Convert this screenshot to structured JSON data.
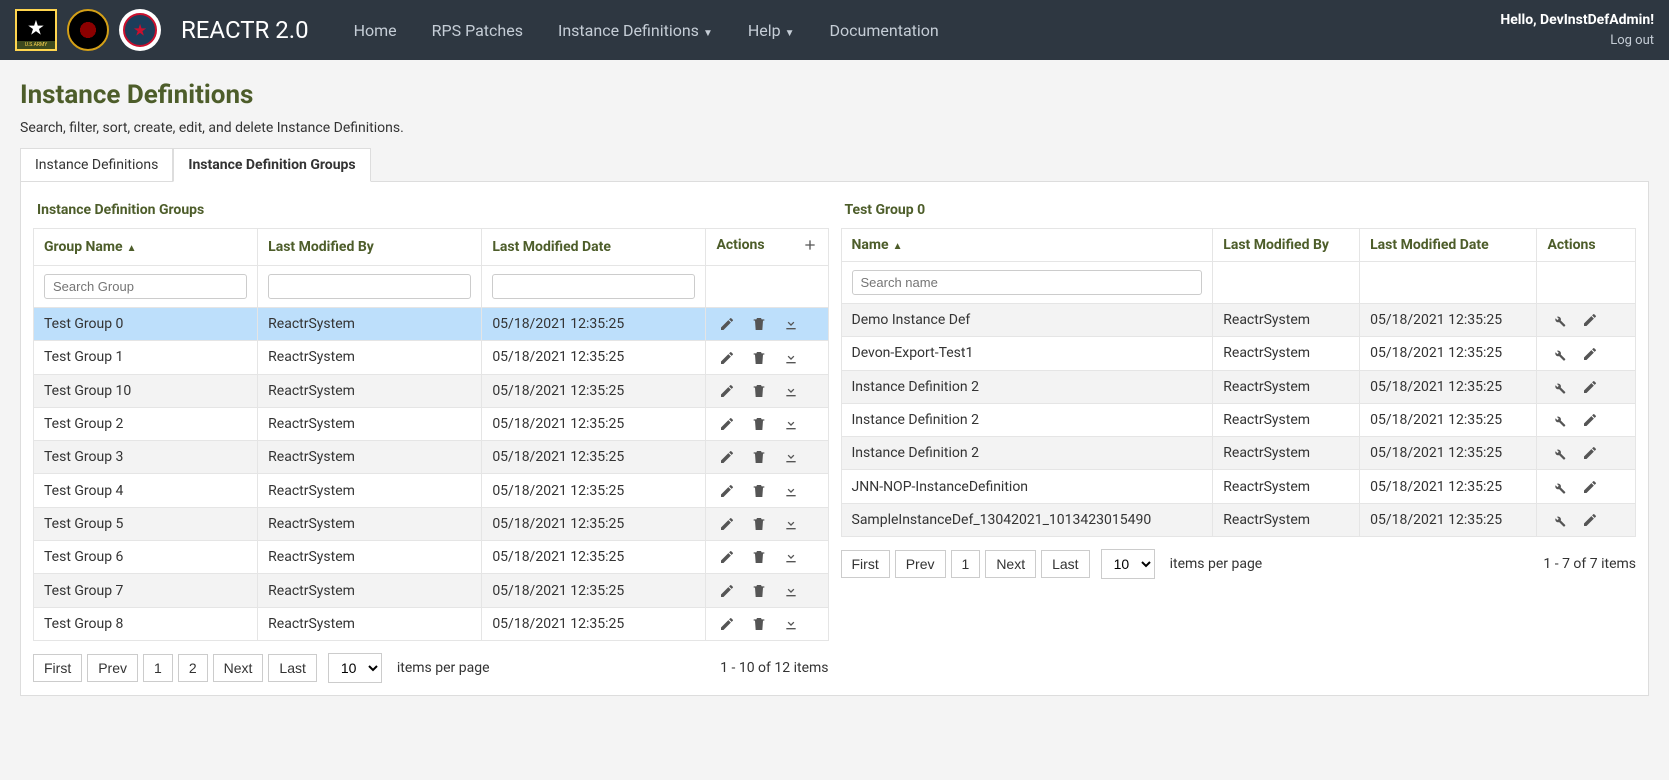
{
  "nav": {
    "brand": "REACTR 2.0",
    "links": {
      "home": "Home",
      "rps": "RPS Patches",
      "instdef": "Instance Definitions",
      "help": "Help",
      "docs": "Documentation"
    },
    "greeting": "Hello, DevInstDefAdmin!",
    "logout": "Log out"
  },
  "page": {
    "title": "Instance Definitions",
    "subtitle": "Search, filter, sort, create, edit, and delete Instance Definitions."
  },
  "tabs": {
    "t1": "Instance Definitions",
    "t2": "Instance Definition Groups"
  },
  "left": {
    "section_title": "Instance Definition Groups",
    "headers": {
      "name": "Group Name",
      "modified_by": "Last Modified By",
      "modified_date": "Last Modified Date",
      "actions": "Actions"
    },
    "search_placeholder": "Search Group",
    "rows": [
      {
        "name": "Test Group 0",
        "by": "ReactrSystem",
        "date": "05/18/2021 12:35:25",
        "selected": true
      },
      {
        "name": "Test Group 1",
        "by": "ReactrSystem",
        "date": "05/18/2021 12:35:25"
      },
      {
        "name": "Test Group 10",
        "by": "ReactrSystem",
        "date": "05/18/2021 12:35:25"
      },
      {
        "name": "Test Group 2",
        "by": "ReactrSystem",
        "date": "05/18/2021 12:35:25"
      },
      {
        "name": "Test Group 3",
        "by": "ReactrSystem",
        "date": "05/18/2021 12:35:25"
      },
      {
        "name": "Test Group 4",
        "by": "ReactrSystem",
        "date": "05/18/2021 12:35:25"
      },
      {
        "name": "Test Group 5",
        "by": "ReactrSystem",
        "date": "05/18/2021 12:35:25"
      },
      {
        "name": "Test Group 6",
        "by": "ReactrSystem",
        "date": "05/18/2021 12:35:25"
      },
      {
        "name": "Test Group 7",
        "by": "ReactrSystem",
        "date": "05/18/2021 12:35:25"
      },
      {
        "name": "Test Group 8",
        "by": "ReactrSystem",
        "date": "05/18/2021 12:35:25"
      }
    ],
    "pager": {
      "first": "First",
      "prev": "Prev",
      "p1": "1",
      "p2": "2",
      "next": "Next",
      "last": "Last",
      "size": "10",
      "per_page": "items per page",
      "summary": "1 - 10 of 12 items"
    }
  },
  "right": {
    "section_title": "Test Group 0",
    "headers": {
      "name": "Name",
      "modified_by": "Last Modified By",
      "modified_date": "Last Modified Date",
      "actions": "Actions"
    },
    "search_placeholder": "Search name",
    "rows": [
      {
        "name": "Demo Instance Def",
        "by": "ReactrSystem",
        "date": "05/18/2021 12:35:25"
      },
      {
        "name": "Devon-Export-Test1",
        "by": "ReactrSystem",
        "date": "05/18/2021 12:35:25"
      },
      {
        "name": "Instance Definition 2",
        "by": "ReactrSystem",
        "date": "05/18/2021 12:35:25"
      },
      {
        "name": "Instance Definition 2",
        "by": "ReactrSystem",
        "date": "05/18/2021 12:35:25"
      },
      {
        "name": "Instance Definition 2",
        "by": "ReactrSystem",
        "date": "05/18/2021 12:35:25"
      },
      {
        "name": "JNN-NOP-InstanceDefinition",
        "by": "ReactrSystem",
        "date": "05/18/2021 12:35:25"
      },
      {
        "name": "SampleInstanceDef_13042021_1013423015490",
        "by": "ReactrSystem",
        "date": "05/18/2021 12:35:25"
      }
    ],
    "pager": {
      "first": "First",
      "prev": "Prev",
      "p1": "1",
      "next": "Next",
      "last": "Last",
      "size": "10",
      "per_page": "items per page",
      "summary": "1 - 7 of 7 items"
    }
  }
}
